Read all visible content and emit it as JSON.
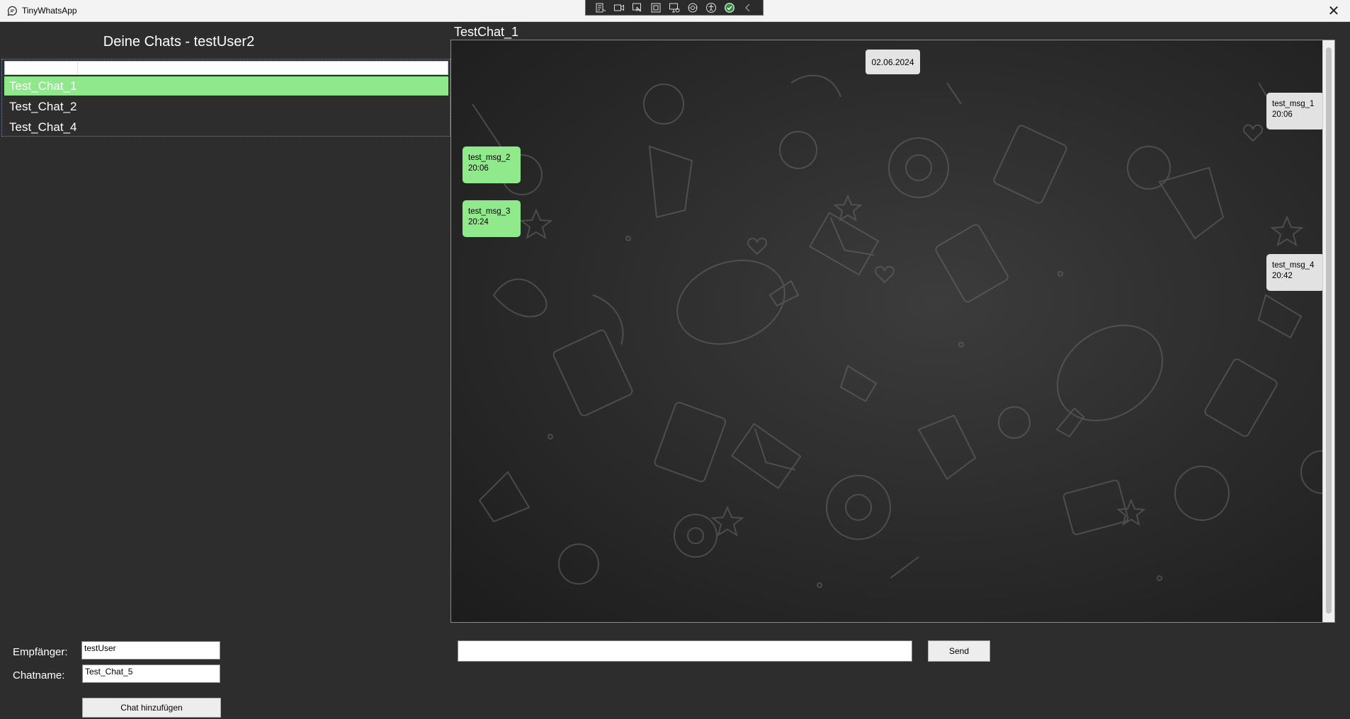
{
  "window": {
    "title": "TinyWhatsApp",
    "app_icon": "chat-bubble-icon",
    "close_icon": "close-icon"
  },
  "debug_toolbar": {
    "icons": [
      "live-visual-tree-icon",
      "video-icon",
      "select-element-icon",
      "display-layout-adorners-icon",
      "track-focused-element-icon",
      "binding-failures-icon",
      "accessibility-icon",
      "checkmark-icon",
      "collapse-chevron-icon"
    ]
  },
  "sidebar": {
    "heading": "Deine Chats - testUser2",
    "chats": [
      "Test_Chat_1",
      "Test_Chat_2",
      "Test_Chat_4"
    ],
    "selected_index": 0
  },
  "new_chat_form": {
    "recipient_label": "Empfänger:",
    "recipient_value": "testUser",
    "chatname_label": "Chatname:",
    "chatname_value": "Test_Chat_5",
    "add_button": "Chat hinzufügen"
  },
  "chat": {
    "title": "TestChat_1",
    "date": "02.06.2024",
    "messages": [
      {
        "text": "test_msg_1",
        "time": "20:06",
        "side": "right"
      },
      {
        "text": "test_msg_2",
        "time": "20:06",
        "side": "left"
      },
      {
        "text": "test_msg_3",
        "time": "20:24",
        "side": "left"
      },
      {
        "text": "test_msg_4",
        "time": "20:42",
        "side": "right"
      }
    ],
    "message_input_value": "",
    "send_button": "Send"
  },
  "colors": {
    "background": "#2d2d2d",
    "selected_chat": "#8fe88c",
    "incoming_bubble": "#90ea8c",
    "outgoing_bubble": "#e2e2e2"
  }
}
